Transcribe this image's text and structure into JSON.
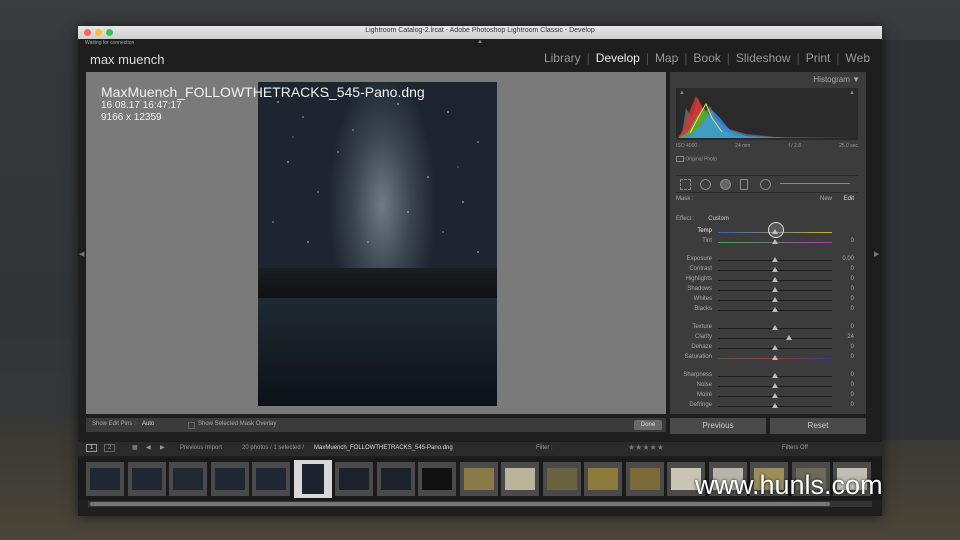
{
  "window": {
    "title": "Lightroom Catalog-2.lrcat - Adobe Photoshop Lightroom Classic - Develop"
  },
  "status": {
    "connection": "Waiting for connection"
  },
  "identity_plate": "max muench",
  "modules": [
    "Library",
    "Develop",
    "Map",
    "Book",
    "Slideshow",
    "Print",
    "Web"
  ],
  "active_module": "Develop",
  "photo_info": {
    "filename": "MaxMuench_FOLLOWTHETRACKS_545-Pano.dng",
    "datetime": "16.08.17 16:47:17",
    "dimensions": "9166 x 12359"
  },
  "histogram": {
    "title": "Histogram",
    "iso": "ISO 4000",
    "focal": "24 mm",
    "aperture": "f / 2.8",
    "shutter": "25.0 sec",
    "original_photo_label": "Original Photo"
  },
  "mask": {
    "label": "Mask :",
    "new": "New",
    "edit": "Edit"
  },
  "effect": {
    "label": "Effect :",
    "value": "Custom"
  },
  "sliders": [
    {
      "label": "Temp",
      "value": "",
      "pos": 0.5,
      "highlight": true
    },
    {
      "label": "Tint",
      "value": "0",
      "pos": 0.5
    },
    {
      "label": "Exposure",
      "value": "0.00",
      "pos": 0.5
    },
    {
      "label": "Contrast",
      "value": "0",
      "pos": 0.5
    },
    {
      "label": "Highlights",
      "value": "0",
      "pos": 0.5
    },
    {
      "label": "Shadows",
      "value": "0",
      "pos": 0.5
    },
    {
      "label": "Whites",
      "value": "0",
      "pos": 0.5
    },
    {
      "label": "Blacks",
      "value": "0",
      "pos": 0.5
    },
    {
      "label": "Texture",
      "value": "0",
      "pos": 0.5
    },
    {
      "label": "Clarity",
      "value": "24",
      "pos": 0.62
    },
    {
      "label": "Dehaze",
      "value": "0",
      "pos": 0.5
    },
    {
      "label": "Saturation",
      "value": "0",
      "pos": 0.5
    },
    {
      "label": "Sharpness",
      "value": "0",
      "pos": 0.5
    },
    {
      "label": "Noise",
      "value": "0",
      "pos": 0.5
    },
    {
      "label": "Moiré",
      "value": "0",
      "pos": 0.5
    },
    {
      "label": "Defringe",
      "value": "0",
      "pos": 0.5
    }
  ],
  "toolbar": {
    "show_edit_pins_label": "Show Edit Pins :",
    "show_edit_pins_value": "Auto",
    "show_mask_overlay": "Show Selected Mask Overlay",
    "done": "Done"
  },
  "buttons": {
    "previous": "Previous",
    "reset": "Reset"
  },
  "filmstrip_bar": {
    "page1": "1",
    "page2": "2",
    "source": "Previous Import",
    "count": "20 photos / 1 selected /",
    "selected_file": "MaxMuench_FOLLOWTHETRACKS_545-Pano.dng",
    "filter_label": "Filter :",
    "filters_off": "Filters Off"
  },
  "watermark": "www.hunls.com",
  "colors": {
    "accent": "#e8e8e8",
    "panel": "#3c3c3c"
  }
}
